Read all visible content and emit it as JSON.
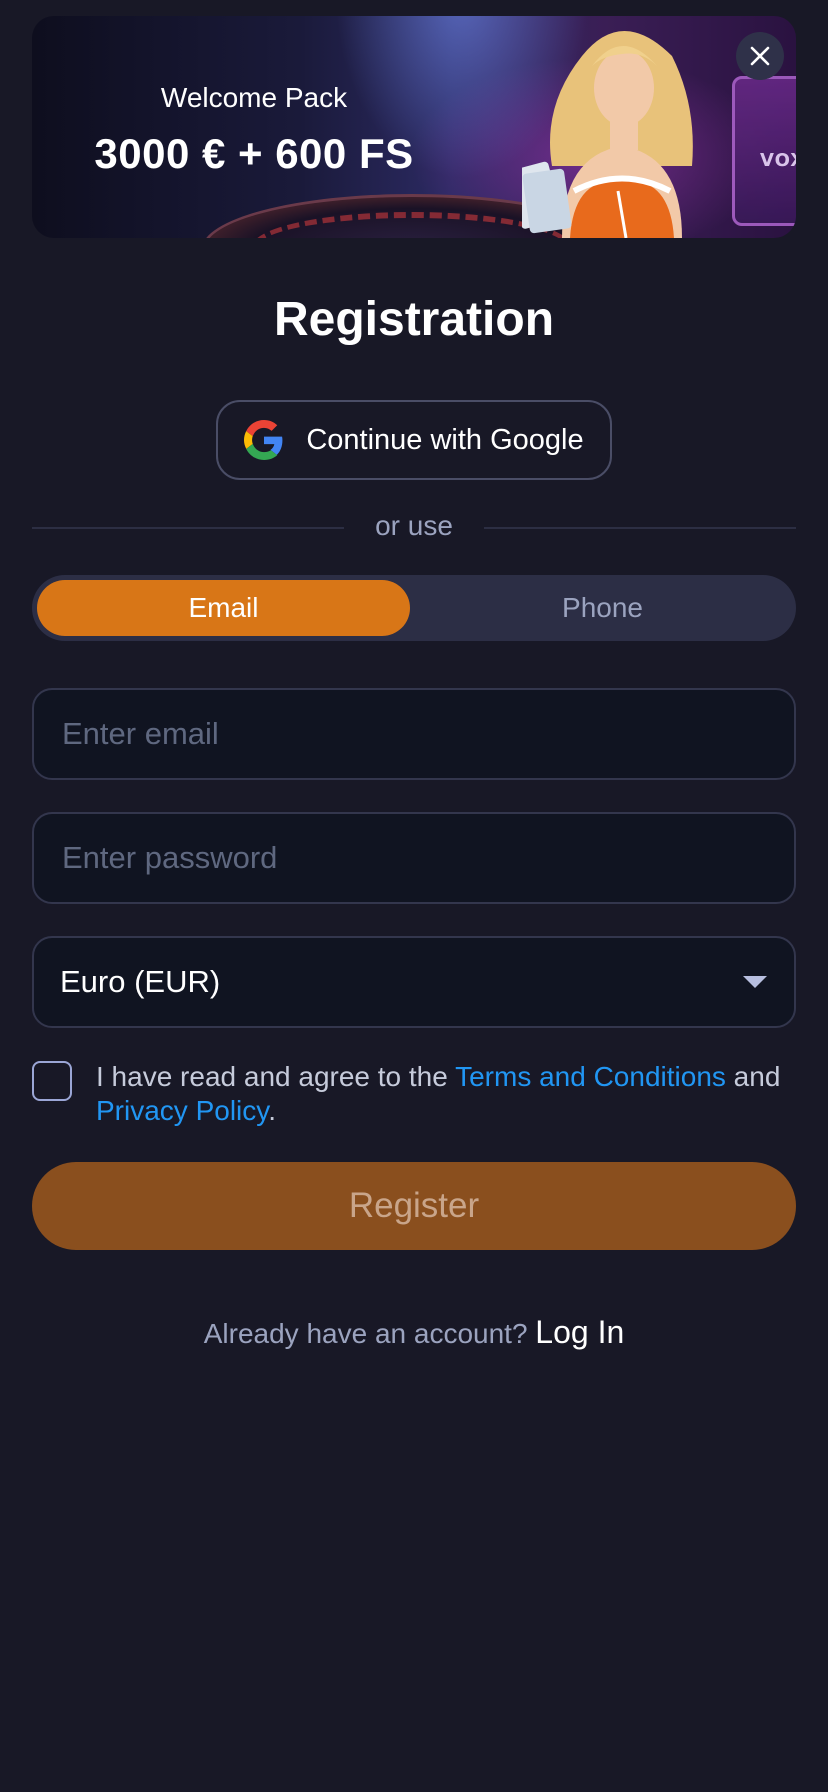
{
  "banner": {
    "subtitle": "Welcome Pack",
    "title": "3000 € + 600 FS",
    "machine_logo": "VOX",
    "close_icon": "close-icon"
  },
  "page": {
    "title": "Registration"
  },
  "google": {
    "label": "Continue with Google",
    "icon": "google-icon"
  },
  "divider": {
    "text": "or use"
  },
  "tabs": [
    {
      "label": "Email",
      "active": true
    },
    {
      "label": "Phone",
      "active": false
    }
  ],
  "form": {
    "email_placeholder": "Enter email",
    "email_value": "",
    "password_placeholder": "Enter password",
    "password_value": "",
    "currency_selected": "Euro (EUR)",
    "currency_icon": "chevron-down-icon"
  },
  "terms": {
    "checked": false,
    "text_before": "I have read and agree to the ",
    "terms_link": "Terms and Conditions",
    "text_middle": " and ",
    "privacy_link": "Privacy Policy",
    "text_after": "."
  },
  "register": {
    "label": "Register"
  },
  "login": {
    "prompt": "Already have an account?",
    "link": "Log In"
  },
  "colors": {
    "background": "#181826",
    "accent": "#d87617",
    "register_disabled": "#8a4f1e",
    "link": "#2196f3"
  }
}
